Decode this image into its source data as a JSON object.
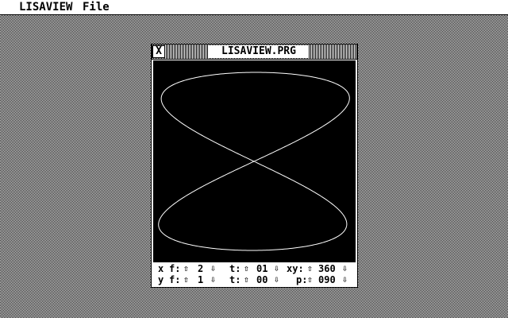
{
  "menubar": {
    "app": "LISAVIEW",
    "file": "File"
  },
  "window": {
    "title": "LISAVIEW.PRG",
    "close_glyph": "X"
  },
  "curve_color": "#ffffff",
  "canvas_color": "#000000",
  "controls": {
    "x": {
      "axis": "x",
      "f_label": "f:",
      "f_value": "2",
      "t_label": "t:",
      "t_value": "01",
      "p_label": "xy:",
      "p_value": "360"
    },
    "y": {
      "axis": "y",
      "f_label": "f:",
      "f_value": "1",
      "t_label": "t:",
      "t_value": "00",
      "p_label": "p:",
      "p_value": "090"
    },
    "up_arrow": "⇧",
    "down_arrow": "⇩"
  }
}
